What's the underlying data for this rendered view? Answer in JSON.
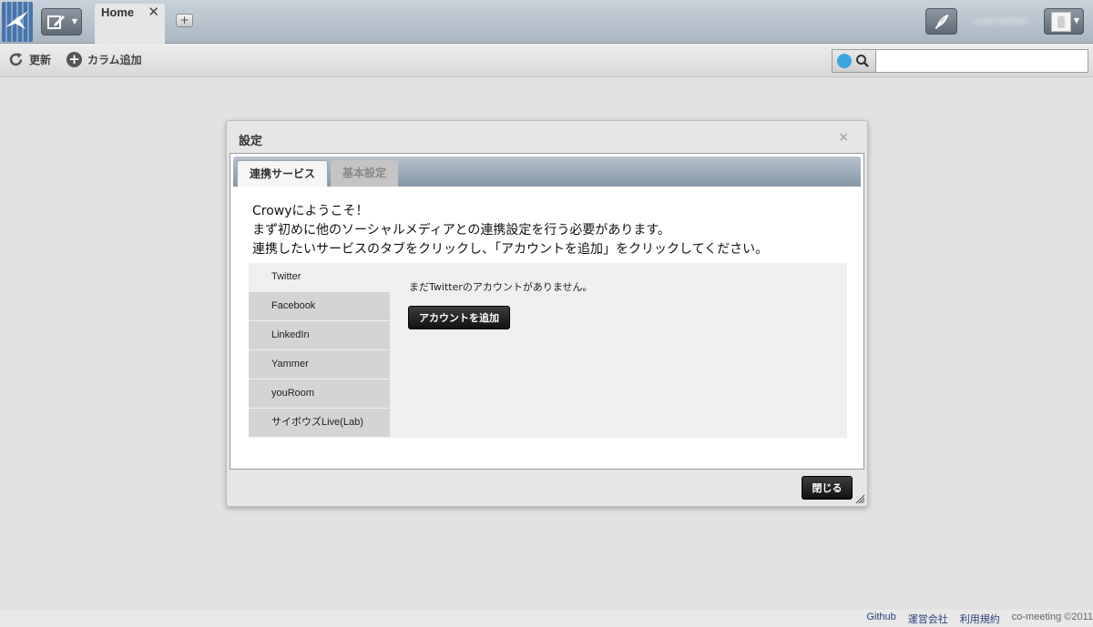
{
  "header": {
    "tab_home": "Home",
    "tab_close": "✕",
    "add_tab": "+",
    "user_name": "username"
  },
  "toolbar": {
    "refresh_label": "更新",
    "add_column_label": "カラム追加",
    "search_placeholder": ""
  },
  "dialog": {
    "title": "設定",
    "close_x": "×",
    "tabs": [
      {
        "label": "連携サービス"
      },
      {
        "label": "基本設定"
      }
    ],
    "intro": {
      "line1": "Crowyにようこそ！",
      "line2": "まず初めに他のソーシャルメディアとの連携設定を行う必要があります。",
      "line3": "連携したいサービスのタブをクリックし、「アカウントを追加」をクリックしてください。"
    },
    "services": [
      {
        "label": "Twitter"
      },
      {
        "label": "Facebook"
      },
      {
        "label": "LinkedIn"
      },
      {
        "label": "Yammer"
      },
      {
        "label": "youRoom"
      },
      {
        "label": "サイボウズLive(Lab)"
      }
    ],
    "service_message": "まだTwitterのアカウントがありません。",
    "add_account_label": "アカウントを追加",
    "close_button_label": "閉じる"
  },
  "footer": {
    "links": [
      {
        "label": "Github"
      },
      {
        "label": "運営会社"
      },
      {
        "label": "利用規約"
      }
    ],
    "copyright": "co-meeting ©2011"
  },
  "colors": {
    "topbar": "#aab6c1",
    "tabbar": "#8596a6",
    "button_dark": "#111111",
    "twitter_blue": "#3aa7e0"
  }
}
